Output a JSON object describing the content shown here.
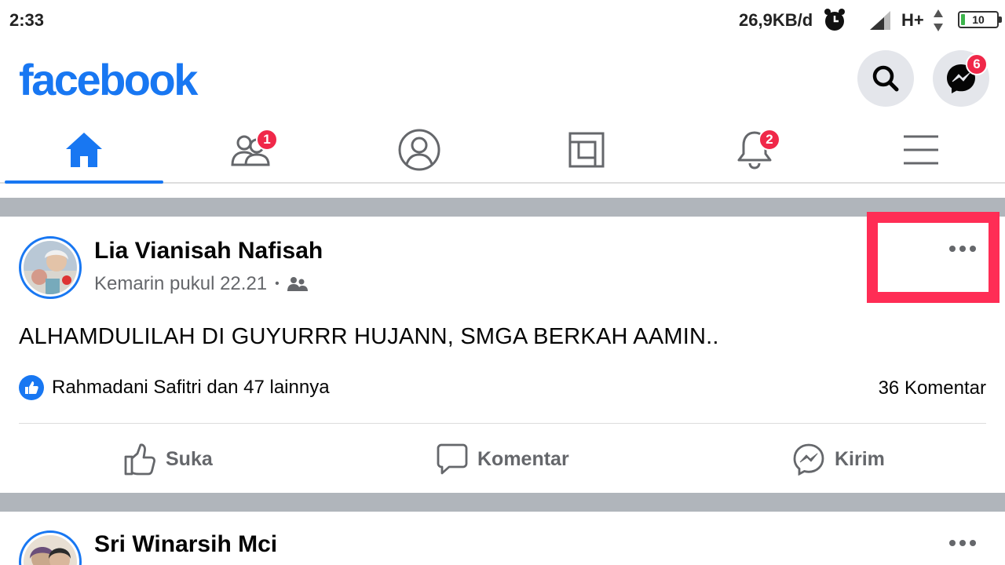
{
  "status_bar": {
    "time": "2:33",
    "speed": "26,9KB/d",
    "network": "H+",
    "battery_level": "10"
  },
  "header": {
    "logo": "facebook",
    "messenger_badge": "6"
  },
  "nav": {
    "friends_badge": "1",
    "notifications_badge": "2"
  },
  "posts": [
    {
      "author": "Lia Vianisah Nafisah",
      "time": "Kemarin pukul 22.21",
      "separator": "•",
      "text": "ALHAMDULILAH DI GUYURRR HUJANN, SMGA BERKAH AAMIN..",
      "reactions": "Rahmadani Safitri dan 47 lainnya",
      "comments": "36 Komentar",
      "actions": {
        "like": "Suka",
        "comment": "Komentar",
        "send": "Kirim"
      }
    },
    {
      "author": "Sri Winarsih Mci"
    }
  ],
  "colors": {
    "brand": "#1877f2",
    "badge": "#f02849",
    "highlight": "#ff2d55"
  }
}
